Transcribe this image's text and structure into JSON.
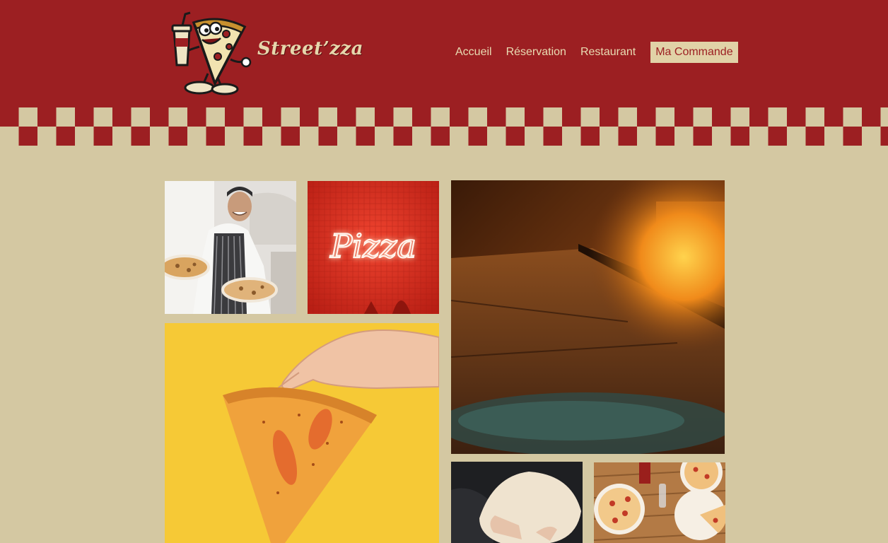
{
  "brand": {
    "name": "Street’zza"
  },
  "nav": {
    "items": [
      {
        "label": "Accueil"
      },
      {
        "label": "Réservation"
      },
      {
        "label": "Restaurant"
      },
      {
        "label": "Ma Commande",
        "active": true
      }
    ]
  },
  "neon_sign": {
    "text": "Pizza"
  },
  "gallery": {
    "images": [
      {
        "subject": "chef-holding-pizzas"
      },
      {
        "subject": "neon-pizza-sign"
      },
      {
        "subject": "wood-fired-oven"
      },
      {
        "subject": "hand-holding-pizza-slice"
      },
      {
        "subject": "hands-stretching-dough"
      },
      {
        "subject": "pizzas-on-table"
      }
    ]
  },
  "colors": {
    "header_red": "#9c1f22",
    "cream": "#d4c8a2",
    "nav_text": "#e9dcb3",
    "active_bg": "#e1d2a7"
  },
  "icons": {
    "logo": "pizza-mascot-icon"
  }
}
